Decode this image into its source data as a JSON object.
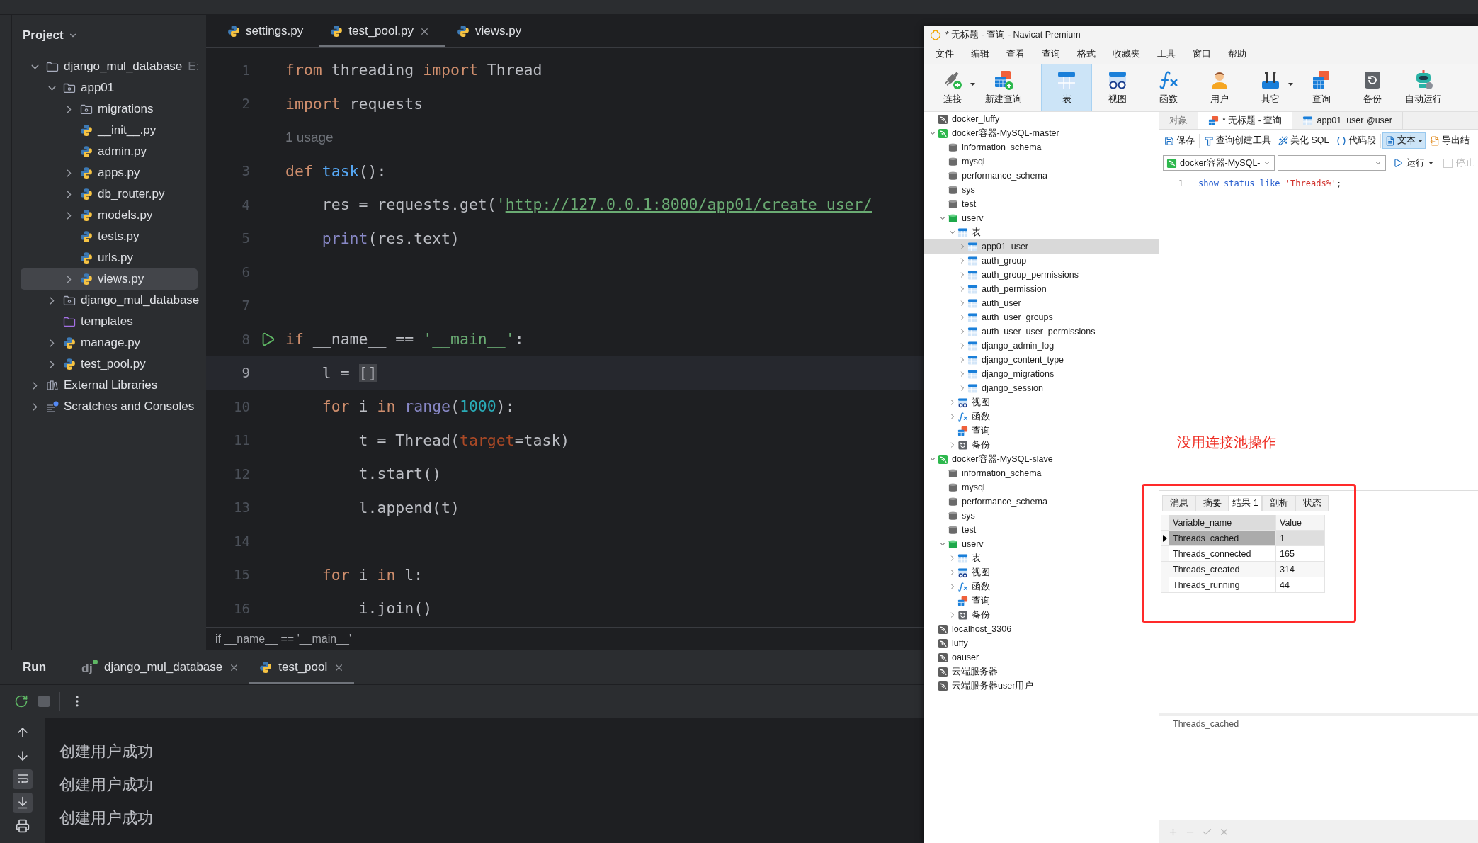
{
  "ide": {
    "project_panel": {
      "title": "Project",
      "tree": [
        {
          "label": "django_mul_database",
          "hint": "E:",
          "kind": "folder",
          "expanded": true,
          "selected": false,
          "children": [
            {
              "label": "app01",
              "kind": "module",
              "expanded": true,
              "selected": false,
              "children": [
                {
                  "label": "migrations",
                  "kind": "module",
                  "expanded": false,
                  "selected": false
                },
                {
                  "label": "__init__.py",
                  "kind": "python",
                  "selected": false
                },
                {
                  "label": "admin.py",
                  "kind": "python",
                  "selected": false
                },
                {
                  "label": "apps.py",
                  "kind": "python",
                  "expanded": false,
                  "selected": false
                },
                {
                  "label": "db_router.py",
                  "kind": "python",
                  "expanded": false,
                  "selected": false
                },
                {
                  "label": "models.py",
                  "kind": "python",
                  "expanded": false,
                  "selected": false
                },
                {
                  "label": "tests.py",
                  "kind": "python",
                  "selected": false
                },
                {
                  "label": "urls.py",
                  "kind": "python",
                  "selected": false
                },
                {
                  "label": "views.py",
                  "kind": "python",
                  "expanded": false,
                  "selected": true
                }
              ]
            },
            {
              "label": "django_mul_database",
              "kind": "module",
              "expanded": false,
              "selected": false
            },
            {
              "label": "templates",
              "kind": "templates",
              "selected": false
            },
            {
              "label": "manage.py",
              "kind": "python",
              "expanded": false,
              "selected": false
            },
            {
              "label": "test_pool.py",
              "kind": "python",
              "expanded": false,
              "selected": false
            }
          ]
        },
        {
          "label": "External Libraries",
          "kind": "library",
          "expanded": false,
          "selected": false
        },
        {
          "label": "Scratches and Consoles",
          "kind": "scratches",
          "expanded": false,
          "selected": false
        }
      ]
    },
    "editor": {
      "tabs": [
        {
          "label": "settings.py",
          "kind": "python",
          "selected": false
        },
        {
          "label": "test_pool.py",
          "kind": "python",
          "selected": true
        },
        {
          "label": "views.py",
          "kind": "python",
          "selected": false
        }
      ],
      "lines": [
        {
          "kind": "code",
          "number": "1",
          "current": false,
          "run_marker": false,
          "tokens": [
            {
              "kind": "keyword",
              "text": "from "
            },
            {
              "kind": "plain",
              "text": "threading "
            },
            {
              "kind": "keyword",
              "text": "import "
            },
            {
              "kind": "plain",
              "text": "Thread"
            }
          ]
        },
        {
          "kind": "code",
          "number": "2",
          "current": false,
          "run_marker": false,
          "tokens": [
            {
              "kind": "keyword",
              "text": "import "
            },
            {
              "kind": "plain",
              "text": "requests"
            }
          ]
        },
        {
          "kind": "hint",
          "text": "1 usage"
        },
        {
          "kind": "code",
          "number": "3",
          "current": false,
          "run_marker": false,
          "tokens": [
            {
              "kind": "keyword",
              "text": "def "
            },
            {
              "kind": "function",
              "text": "task"
            },
            {
              "kind": "plain",
              "text": "():"
            }
          ]
        },
        {
          "kind": "code",
          "number": "4",
          "current": false,
          "run_marker": false,
          "tokens": [
            {
              "kind": "plain",
              "text": "    res = requests.get("
            },
            {
              "kind": "string",
              "text": "'"
            },
            {
              "kind": "url",
              "text": "http://127.0.0.1:8000/app01/create_user/"
            }
          ]
        },
        {
          "kind": "code",
          "number": "5",
          "current": false,
          "run_marker": false,
          "tokens": [
            {
              "kind": "builtin",
              "text": "    print"
            },
            {
              "kind": "plain",
              "text": "(res.text)"
            }
          ]
        },
        {
          "kind": "code",
          "number": "6",
          "current": false,
          "run_marker": false
        },
        {
          "kind": "code",
          "number": "7",
          "current": false,
          "run_marker": false
        },
        {
          "kind": "code",
          "number": "8",
          "current": false,
          "run_marker": true,
          "tokens": [
            {
              "kind": "keyword",
              "text": "if "
            },
            {
              "kind": "plain",
              "text": "__name__ == "
            },
            {
              "kind": "string",
              "text": "'__main__'"
            },
            {
              "kind": "plain",
              "text": ":"
            }
          ]
        },
        {
          "kind": "code",
          "number": "9",
          "current": true,
          "run_marker": false,
          "tokens": [
            {
              "kind": "plain",
              "text": "    l = "
            },
            {
              "kind": "bracket",
              "text": "[]"
            }
          ]
        },
        {
          "kind": "code",
          "number": "10",
          "current": false,
          "run_marker": false,
          "tokens": [
            {
              "kind": "keyword",
              "text": "    for "
            },
            {
              "kind": "plain",
              "text": "i "
            },
            {
              "kind": "keyword",
              "text": "in "
            },
            {
              "kind": "builtin",
              "text": "range"
            },
            {
              "kind": "plain",
              "text": "("
            },
            {
              "kind": "number",
              "text": "1000"
            },
            {
              "kind": "plain",
              "text": "):"
            }
          ]
        },
        {
          "kind": "code",
          "number": "11",
          "current": false,
          "run_marker": false,
          "tokens": [
            {
              "kind": "plain",
              "text": "        t = Thread("
            },
            {
              "kind": "param",
              "text": "target"
            },
            {
              "kind": "plain",
              "text": "=task)"
            }
          ]
        },
        {
          "kind": "code",
          "number": "12",
          "current": false,
          "run_marker": false,
          "tokens": [
            {
              "kind": "plain",
              "text": "        t.start()"
            }
          ]
        },
        {
          "kind": "code",
          "number": "13",
          "current": false,
          "run_marker": false,
          "tokens": [
            {
              "kind": "plain",
              "text": "        l.append(t)"
            }
          ]
        },
        {
          "kind": "code",
          "number": "14",
          "current": false,
          "run_marker": false
        },
        {
          "kind": "code",
          "number": "15",
          "current": false,
          "run_marker": false,
          "tokens": [
            {
              "kind": "keyword",
              "text": "    for "
            },
            {
              "kind": "plain",
              "text": "i "
            },
            {
              "kind": "keyword",
              "text": "in "
            },
            {
              "kind": "plain",
              "text": "l:"
            }
          ]
        },
        {
          "kind": "code",
          "number": "16",
          "current": false,
          "run_marker": false,
          "tokens": [
            {
              "kind": "plain",
              "text": "        i.join()"
            }
          ]
        }
      ],
      "breadcrumb": "if __name__ == '__main__'"
    },
    "run_panel": {
      "title": "Run",
      "tabs": [
        {
          "label": "django_mul_database",
          "kind": "django",
          "badge": "dj",
          "selected": false
        },
        {
          "label": "test_pool",
          "kind": "python",
          "selected": true
        }
      ],
      "soft_wrap": true,
      "scroll_to_end": true,
      "output": [
        "创建用户成功",
        "创建用户成功",
        "创建用户成功"
      ]
    }
  },
  "navicat": {
    "title": "* 无标题 - 查询 - Navicat Premium",
    "menu": [
      "文件",
      "编辑",
      "查看",
      "查询",
      "格式",
      "收藏夹",
      "工具",
      "窗口",
      "帮助"
    ],
    "toolbar": [
      {
        "label": "连接",
        "kind": "connect",
        "dropdown": true,
        "selected": false
      },
      {
        "label": "新建查询",
        "kind": "new_query",
        "dropdown": false,
        "selected": false
      },
      {
        "label": "表",
        "kind": "table",
        "dropdown": false,
        "selected": true
      },
      {
        "label": "视图",
        "kind": "view",
        "dropdown": false,
        "selected": false
      },
      {
        "label": "函数",
        "kind": "function",
        "dropdown": false,
        "selected": false
      },
      {
        "label": "用户",
        "kind": "user",
        "dropdown": false,
        "selected": false
      },
      {
        "label": "其它",
        "kind": "other",
        "dropdown": true,
        "selected": false
      },
      {
        "label": "查询",
        "kind": "query",
        "dropdown": false,
        "selected": false
      },
      {
        "label": "备份",
        "kind": "backup",
        "dropdown": false,
        "selected": false
      },
      {
        "label": "自动运行",
        "kind": "automation",
        "dropdown": false,
        "selected": false
      }
    ],
    "tree": [
      {
        "label": "docker_luffy",
        "kind": "connection",
        "selected": false
      },
      {
        "label": "docker容器-MySQL-master",
        "kind": "connection",
        "expanded": true,
        "selected": false,
        "children": [
          {
            "label": "information_schema",
            "kind": "database",
            "selected": false
          },
          {
            "label": "mysql",
            "kind": "database",
            "selected": false
          },
          {
            "label": "performance_schema",
            "kind": "database",
            "selected": false
          },
          {
            "label": "sys",
            "kind": "database",
            "selected": false
          },
          {
            "label": "test",
            "kind": "database",
            "selected": false
          },
          {
            "label": "userv",
            "kind": "database",
            "expanded": true,
            "selected": false,
            "children": [
              {
                "label": "表",
                "kind": "tables",
                "expanded": true,
                "selected": false,
                "children": [
                  {
                    "label": "app01_user",
                    "kind": "table",
                    "expanded": false,
                    "selected": true
                  },
                  {
                    "label": "auth_group",
                    "kind": "table",
                    "expanded": false,
                    "selected": false
                  },
                  {
                    "label": "auth_group_permissions",
                    "kind": "table",
                    "expanded": false,
                    "selected": false
                  },
                  {
                    "label": "auth_permission",
                    "kind": "table",
                    "expanded": false,
                    "selected": false
                  },
                  {
                    "label": "auth_user",
                    "kind": "table",
                    "expanded": false,
                    "selected": false
                  },
                  {
                    "label": "auth_user_groups",
                    "kind": "table",
                    "expanded": false,
                    "selected": false
                  },
                  {
                    "label": "auth_user_user_permissions",
                    "kind": "table",
                    "expanded": false,
                    "selected": false
                  },
                  {
                    "label": "django_admin_log",
                    "kind": "table",
                    "expanded": false,
                    "selected": false
                  },
                  {
                    "label": "django_content_type",
                    "kind": "table",
                    "expanded": false,
                    "selected": false
                  },
                  {
                    "label": "django_migrations",
                    "kind": "table",
                    "expanded": false,
                    "selected": false
                  },
                  {
                    "label": "django_session",
                    "kind": "table",
                    "expanded": false,
                    "selected": false
                  }
                ]
              },
              {
                "label": "视图",
                "kind": "views",
                "expanded": false,
                "selected": false
              },
              {
                "label": "函数",
                "kind": "functions",
                "expanded": false,
                "selected": false
              },
              {
                "label": "查询",
                "kind": "queries",
                "selected": false
              },
              {
                "label": "备份",
                "kind": "backups",
                "expanded": false,
                "selected": false
              }
            ]
          }
        ]
      },
      {
        "label": "docker容器-MySQL-slave",
        "kind": "connection",
        "expanded": true,
        "selected": false,
        "children": [
          {
            "label": "information_schema",
            "kind": "database",
            "selected": false
          },
          {
            "label": "mysql",
            "kind": "database",
            "selected": false
          },
          {
            "label": "performance_schema",
            "kind": "database",
            "selected": false
          },
          {
            "label": "sys",
            "kind": "database",
            "selected": false
          },
          {
            "label": "test",
            "kind": "database",
            "selected": false
          },
          {
            "label": "userv",
            "kind": "database",
            "expanded": true,
            "selected": false,
            "children": [
              {
                "label": "表",
                "kind": "tables",
                "expanded": false,
                "selected": false
              },
              {
                "label": "视图",
                "kind": "views",
                "expanded": false,
                "selected": false
              },
              {
                "label": "函数",
                "kind": "functions",
                "expanded": false,
                "selected": false
              },
              {
                "label": "查询",
                "kind": "queries",
                "selected": false
              },
              {
                "label": "备份",
                "kind": "backups",
                "expanded": false,
                "selected": false
              }
            ]
          }
        ]
      },
      {
        "label": "localhost_3306",
        "kind": "connection",
        "selected": false
      },
      {
        "label": "luffy",
        "kind": "connection",
        "selected": false
      },
      {
        "label": "oauser",
        "kind": "connection",
        "selected": false
      },
      {
        "label": "云端服务器",
        "kind": "connection",
        "selected": false
      },
      {
        "label": "云端服务器user用户",
        "kind": "connection",
        "selected": false
      }
    ],
    "tabs": [
      {
        "label": "对象",
        "kind": "objects",
        "selected": false
      },
      {
        "label": "* 无标题 - 查询",
        "kind": "query",
        "selected": true
      },
      {
        "label": "app01_user @user",
        "kind": "table",
        "selected": false
      }
    ],
    "query_toolbar": [
      {
        "label": "保存",
        "kind": "save",
        "pressed": false,
        "dropdown": false
      },
      {
        "label": "查询创建工具",
        "kind": "builder",
        "pressed": false,
        "dropdown": false
      },
      {
        "label": "美化 SQL",
        "kind": "beautify",
        "pressed": false,
        "dropdown": false
      },
      {
        "label": "代码段",
        "kind": "snippet",
        "pressed": false,
        "dropdown": false
      },
      {
        "label": "文本",
        "kind": "text",
        "pressed": true,
        "dropdown": true
      },
      {
        "label": "导出结",
        "kind": "export",
        "pressed": false,
        "dropdown": false
      }
    ],
    "connection_select": {
      "value": "docker容器-MySQL-"
    },
    "run": {
      "label": "运行"
    },
    "stop": {
      "label": "停止",
      "disabled": true
    },
    "sql": [
      {
        "number": "1",
        "tokens": [
          {
            "kind": "keyword",
            "text": "show status like "
          },
          {
            "kind": "string",
            "text": "'Threads%'"
          },
          {
            "kind": "plain",
            "text": ";"
          }
        ]
      }
    ],
    "result": {
      "tabs": [
        {
          "label": "消息",
          "selected": false
        },
        {
          "label": "摘要",
          "selected": false
        },
        {
          "label": "结果 1",
          "selected": true
        },
        {
          "label": "剖析",
          "selected": false
        },
        {
          "label": "状态",
          "selected": false
        }
      ],
      "columns": [
        "Variable_name",
        "Value"
      ],
      "rows": [
        {
          "cells": [
            "Threads_cached",
            "1"
          ],
          "selected": true
        },
        {
          "cells": [
            "Threads_connected",
            "165"
          ],
          "selected": false
        },
        {
          "cells": [
            "Threads_created",
            "314"
          ],
          "selected": false
        },
        {
          "cells": [
            "Threads_running",
            "44"
          ],
          "selected": false
        }
      ],
      "detail": "Threads_cached"
    }
  },
  "annotation": {
    "text": "没用连接池操作"
  }
}
